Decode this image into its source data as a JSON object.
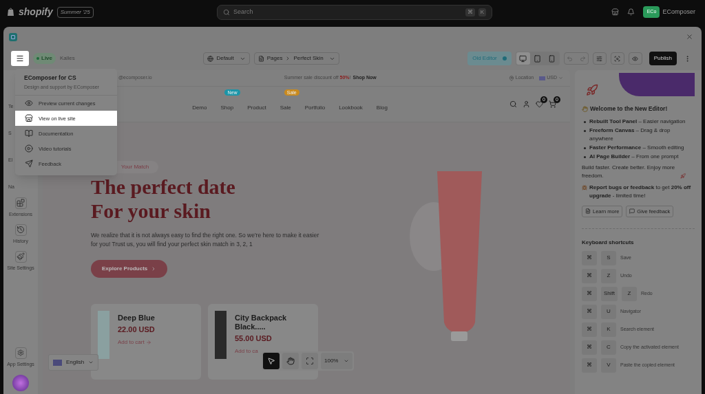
{
  "topbar": {
    "brand": "shopify",
    "edition": "Summer '25",
    "search": {
      "placeholder": "Search",
      "keys": [
        "⌘",
        "K"
      ]
    },
    "account": {
      "initials": "ECo",
      "name": "EComposer"
    }
  },
  "toolbar": {
    "status": "Live",
    "store": "Kalles",
    "template": "Default",
    "breadcrumb": [
      "Pages",
      "Perfect Skin"
    ],
    "old_editor": {
      "label": "Old Editor",
      "on": true
    },
    "devices": [
      {
        "kind": "desktop",
        "selected": true
      },
      {
        "kind": "tablet",
        "selected": false
      },
      {
        "kind": "mobile",
        "selected": false
      }
    ],
    "publish": "Publish"
  },
  "menu": {
    "open": true,
    "title": "EComposer for CS",
    "subtitle": "Design and support by EComposer",
    "items": [
      {
        "label": "Preview current changes",
        "kind": "eye",
        "selected": false
      },
      {
        "label": "View on live site",
        "kind": "store",
        "selected": true
      },
      {
        "label": "Documentation",
        "kind": "book",
        "selected": false
      },
      {
        "label": "Video tutorials",
        "kind": "play",
        "selected": false
      },
      {
        "label": "Feedback",
        "kind": "send",
        "selected": false
      }
    ]
  },
  "sidebar": {
    "items": [
      {
        "label": "Te",
        "kind": "covered"
      },
      {
        "label": "S",
        "kind": "covered"
      },
      {
        "label": "El",
        "kind": "covered"
      },
      {
        "label": "Na",
        "kind": "covered"
      },
      {
        "label": "Extensions",
        "kind": "extensions"
      },
      {
        "label": "History",
        "kind": "history"
      },
      {
        "label": "Site Settings",
        "kind": "site-settings"
      }
    ],
    "footer": "App Settings"
  },
  "store_preview": {
    "announcement": {
      "contact": "@ecomposer.io",
      "promo": "Summer sale discount off **50%**!",
      "link": "Shop Now",
      "location": "Location",
      "currency": "USD"
    },
    "nav": [
      {
        "label": "Demo"
      },
      {
        "label": "Shop",
        "badge": {
          "text": "New",
          "color": "#1b95a8"
        }
      },
      {
        "label": "Product"
      },
      {
        "label": "Sale",
        "badge": {
          "text": "Sale",
          "color": "#c98a1e"
        }
      },
      {
        "label": "Portfolio"
      },
      {
        "label": "Lookbook"
      },
      {
        "label": "Blog"
      }
    ],
    "wishlist_count": "0",
    "cart_count": "0",
    "hero": {
      "eyebrow": "Your Match",
      "title": [
        "The perfect date",
        "For your skin"
      ],
      "text": "We realize that it is not always easy to find the right one. So we're here to make it easier for you! Trust us, you will find your perfect skin match in 3, 2, 1",
      "button": "Explore Products"
    },
    "products": [
      {
        "name": "Deep Blue",
        "price": "22.00 USD",
        "action": "Add to cart",
        "kind": "watch"
      },
      {
        "name": "City Backpack Black.....",
        "price": "55.00 USD",
        "action": "Add to ca",
        "kind": "bag"
      }
    ],
    "language": "English",
    "tools": [
      {
        "kind": "pointer",
        "selected": true
      },
      {
        "kind": "hand",
        "selected": false
      },
      {
        "kind": "focus",
        "selected": false
      }
    ],
    "zoom": "100%"
  },
  "panel": {
    "welcome": "Welcome to the New Editor!",
    "features": [
      "**Rebuilt Tool Panel** – Easier navigation",
      "**Freeform Canvas** – Drag & drop anywhere",
      "**Faster Performance** – Smooth editing",
      "**AI Page Builder** – From one prompt"
    ],
    "tagline": "Build faster. Create better. Enjoy more freedom.",
    "report": "**Report bugs or feedback** to get **20% off upgrade** - limited time!",
    "buttons": [
      {
        "label": "Learn more",
        "kind": "doc"
      },
      {
        "label": "Give feedback",
        "kind": "note"
      }
    ],
    "shortcuts_title": "Keyboard shortcuts",
    "shortcuts": [
      {
        "keys": [
          "⌘",
          "S"
        ],
        "action": "Save"
      },
      {
        "keys": [
          "⌘",
          "Z"
        ],
        "action": "Undo"
      },
      {
        "keys": [
          "⌘",
          "Shift",
          "Z"
        ],
        "action": "Redo"
      },
      {
        "keys": [
          "⌘",
          "U"
        ],
        "action": "Navigator"
      },
      {
        "keys": [
          "⌘",
          "K"
        ],
        "action": "Search element"
      },
      {
        "keys": [
          "⌘",
          "C"
        ],
        "action": "Copy the activated element"
      },
      {
        "keys": [
          "⌘",
          "V"
        ],
        "action": "Paste the copied element"
      }
    ]
  }
}
